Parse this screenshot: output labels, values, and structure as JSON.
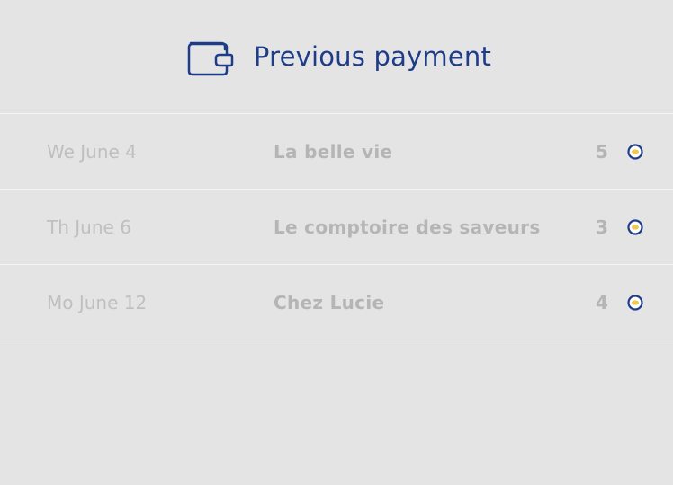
{
  "header": {
    "title": "Previous payment",
    "icon": "wallet-icon",
    "accent_color": "#1f3c88"
  },
  "payments": [
    {
      "date": "We June 4",
      "place": "La belle vie",
      "count": "5",
      "icon": "coin-icon"
    },
    {
      "date": "Th June 6",
      "place": "Le comptoire des saveurs",
      "count": "3",
      "icon": "coin-icon"
    },
    {
      "date": "Mo June 12",
      "place": "Chez Lucie",
      "count": "4",
      "icon": "coin-icon"
    }
  ],
  "colors": {
    "background": "#e4e4e4",
    "divider": "#f4f4f4",
    "muted_text": "#b5b5b5",
    "coin_fill": "#f2c94c"
  }
}
